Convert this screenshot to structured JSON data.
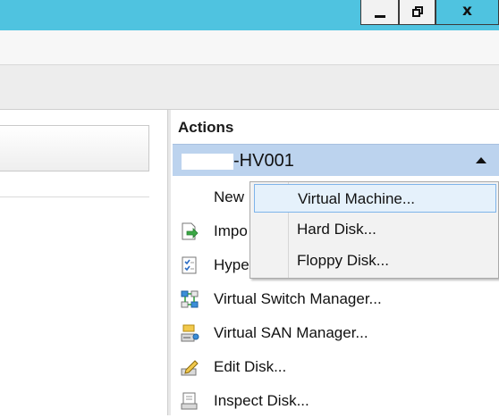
{
  "window": {
    "minimize_icon": "minimize-icon",
    "restore_icon": "restore-icon",
    "close_label": "x",
    "colors": {
      "titlebar": "#4fc3e0",
      "selection_header": "#bcd3ee",
      "hover": "#e5f1fb"
    }
  },
  "actions": {
    "title": "Actions",
    "server_name": "-HV001",
    "items": [
      {
        "label": "New",
        "icon": "new-icon"
      },
      {
        "label": "Impo",
        "icon": "import-icon"
      },
      {
        "label": "Hype",
        "icon": "hyper-v-settings-icon"
      },
      {
        "label": "Virtual Switch Manager...",
        "icon": "virtual-switch-icon"
      },
      {
        "label": "Virtual SAN Manager...",
        "icon": "virtual-san-icon"
      },
      {
        "label": "Edit Disk...",
        "icon": "edit-disk-icon"
      },
      {
        "label": "Inspect Disk...",
        "icon": "inspect-disk-icon"
      }
    ]
  },
  "submenu": {
    "items": [
      {
        "label": "Virtual Machine...",
        "hovered": true
      },
      {
        "label": "Hard Disk..."
      },
      {
        "label": "Floppy Disk..."
      }
    ]
  }
}
